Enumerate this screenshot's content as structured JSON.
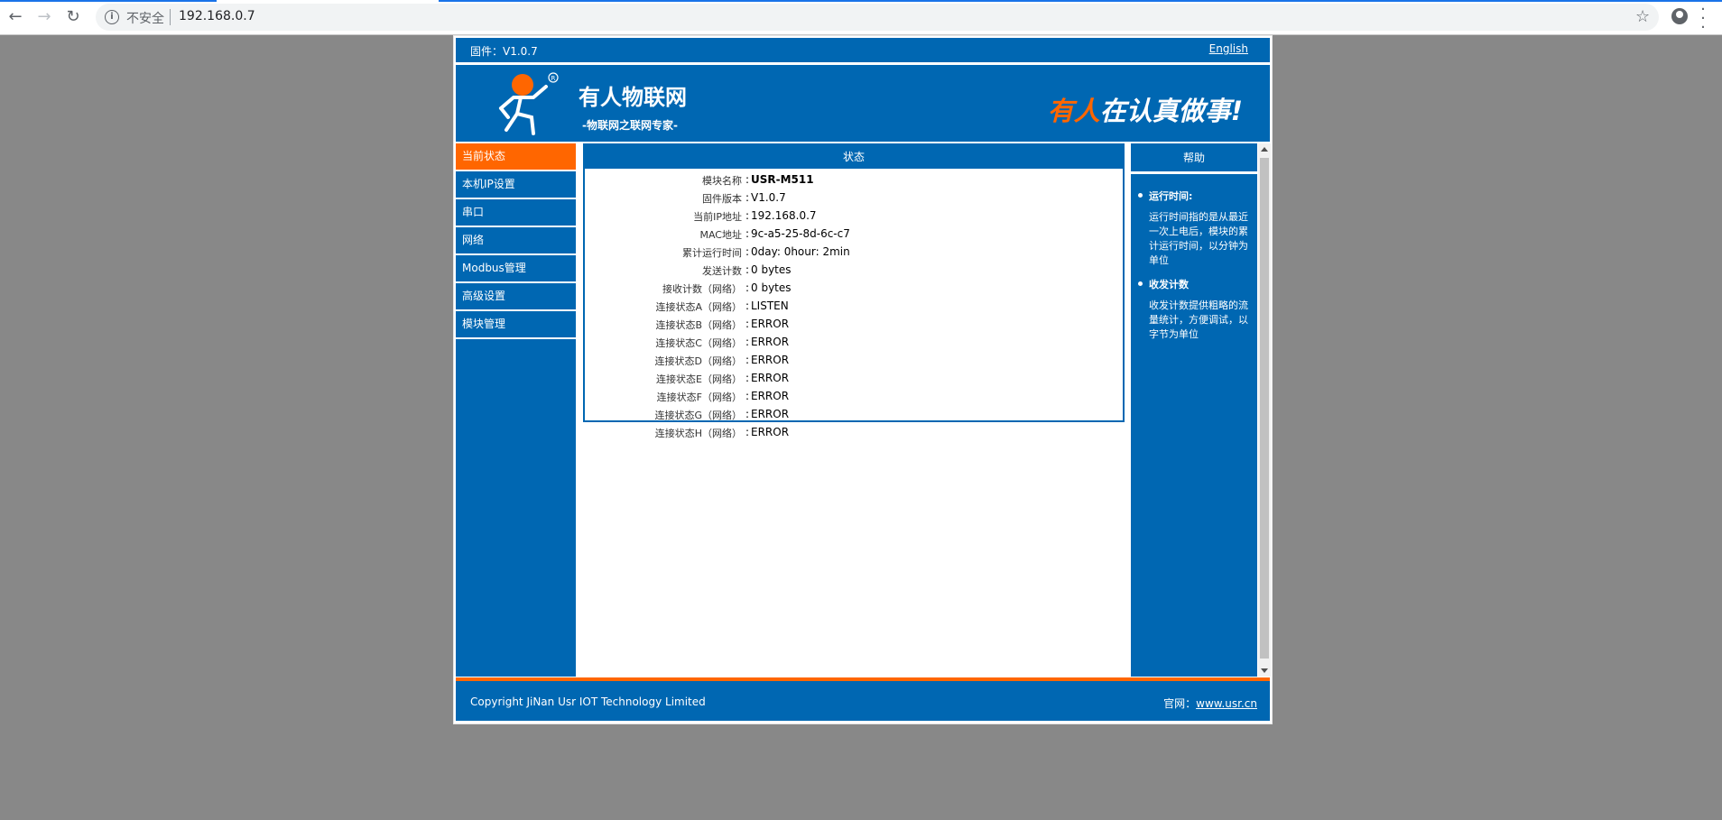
{
  "browser": {
    "security_label": "不安全",
    "url": "192.168.0.7"
  },
  "topbar": {
    "firmware": "固件：V1.0.7",
    "language": "English"
  },
  "banner": {
    "brand": "有人物联网",
    "subtitle": "-物联网之联网专家-",
    "slogan_highlight": "有人",
    "slogan_rest": "在认真做事!",
    "accent_color": "#ff6600",
    "brand_color": "#0067b2"
  },
  "sidebar": {
    "items": [
      {
        "label": "当前状态",
        "active": true
      },
      {
        "label": "本机IP设置",
        "active": false
      },
      {
        "label": "串口",
        "active": false
      },
      {
        "label": "网络",
        "active": false
      },
      {
        "label": "Modbus管理",
        "active": false
      },
      {
        "label": "高级设置",
        "active": false
      },
      {
        "label": "模块管理",
        "active": false
      }
    ]
  },
  "status": {
    "title": "状态",
    "rows": [
      {
        "label": "模块名称",
        "value": "USR-M511"
      },
      {
        "label": "固件版本",
        "value": "V1.0.7"
      },
      {
        "label": "当前IP地址",
        "value": "192.168.0.7"
      },
      {
        "label": "MAC地址",
        "value": "9c-a5-25-8d-6c-c7"
      },
      {
        "label": "累计运行时间",
        "value": "0day: 0hour: 2min"
      },
      {
        "label": "发送计数",
        "value": "0 bytes"
      },
      {
        "label": "接收计数（网络）",
        "value": "0 bytes"
      },
      {
        "label": "连接状态A（网络）",
        "value": "LISTEN"
      },
      {
        "label": "连接状态B（网络）",
        "value": "ERROR"
      },
      {
        "label": "连接状态C（网络）",
        "value": "ERROR"
      },
      {
        "label": "连接状态D（网络）",
        "value": "ERROR"
      },
      {
        "label": "连接状态E（网络）",
        "value": "ERROR"
      },
      {
        "label": "连接状态F（网络）",
        "value": "ERROR"
      },
      {
        "label": "连接状态G（网络）",
        "value": "ERROR"
      },
      {
        "label": "连接状态H（网络）",
        "value": "ERROR"
      }
    ]
  },
  "help": {
    "title": "帮助",
    "sections": [
      {
        "title": "运行时间:",
        "text": "运行时间指的是从最近一次上电后，模块的累计运行时间，以分钟为单位"
      },
      {
        "title": "收发计数",
        "text": "收发计数提供粗略的流量统计，方便调试，以字节为单位"
      }
    ]
  },
  "footer": {
    "copyright": "Copyright JiNan Usr IOT Technology Limited",
    "site_label": "官网：",
    "site_link": "www.usr.cn"
  }
}
